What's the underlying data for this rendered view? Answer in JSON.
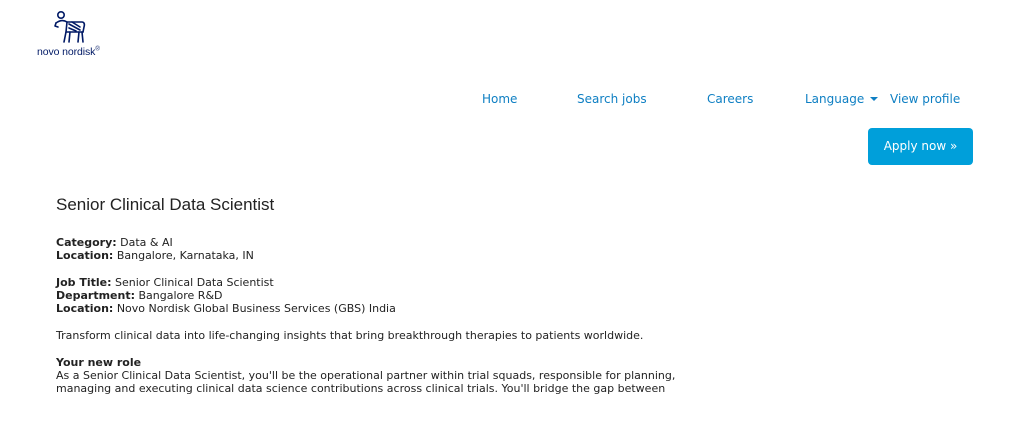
{
  "brand": {
    "logo_text": "novo nordisk",
    "logo_reg": "®",
    "logo_icon": "apis-bull-icon"
  },
  "nav": {
    "home": "Home",
    "search_jobs": "Search jobs",
    "careers": "Careers",
    "language": "Language",
    "view_profile": "View profile"
  },
  "apply": {
    "label": "Apply now »"
  },
  "job": {
    "title": "Senior Clinical Data Scientist",
    "summary": {
      "category_label": "Category:",
      "category_value": "Data & AI",
      "location_label": "Location:",
      "location_value": "Bangalore, Karnataka, IN"
    },
    "details": {
      "job_title_label": "Job Title:",
      "job_title_value": "Senior Clinical Data Scientist",
      "department_label": "Department:",
      "department_value": "Bangalore R&D",
      "location_label": "Location:",
      "location_value": "Novo Nordisk Global Business Services (GBS) India"
    },
    "intro": "Transform clinical data into life-changing insights that bring breakthrough therapies to patients worldwide.",
    "role": {
      "heading": "Your new role",
      "line1": "As a Senior Clinical Data Scientist, you'll be the operational partner within trial squads, responsible for planning,",
      "line2": "managing and executing clinical data science contributions across clinical trials. You'll bridge the gap between"
    }
  },
  "colors": {
    "link": "#0e7fc3",
    "button": "#009fda",
    "logo": "#001965",
    "text": "#222222"
  }
}
